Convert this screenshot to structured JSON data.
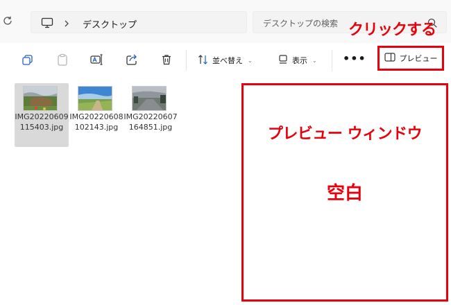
{
  "address_bar": {
    "breadcrumb": "デスクトップ",
    "search_placeholder": "デスクトップの検索"
  },
  "toolbar": {
    "sort_label": "並べ替え",
    "view_label": "表示",
    "more_label": "•••",
    "preview_label": "プレビュー"
  },
  "annotations": {
    "click_callout": "クリックする",
    "pane_title": "プレビュー ウィンドウ",
    "pane_empty": "空白",
    "highlight_color": "#e8000b"
  },
  "files": [
    {
      "name": "IMG20220609115403.jpg",
      "selected": true
    },
    {
      "name": "IMG20220608102143.jpg",
      "selected": false
    },
    {
      "name": "IMG20220607164851.jpg",
      "selected": false
    }
  ],
  "icons": [
    "refresh-icon",
    "monitor-icon",
    "chevron-right-icon",
    "search-icon",
    "new-item-icon",
    "copy-icon",
    "paste-icon",
    "rename-icon",
    "share-icon",
    "delete-icon",
    "sort-icon",
    "view-icon",
    "preview-pane-icon"
  ]
}
